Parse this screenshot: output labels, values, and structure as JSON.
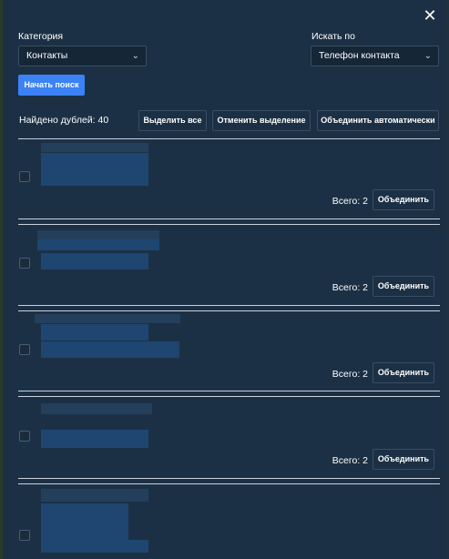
{
  "close_icon": "close-icon",
  "filters": {
    "category_label": "Категория",
    "category_value": "Контакты",
    "search_by_label": "Искать по",
    "search_by_value": "Телефон контакта",
    "start_search": "Начать поиск"
  },
  "toolbar": {
    "found_text": "Найдено дублей: 40",
    "select_all": "Выделить все",
    "deselect": "Отменить выделение",
    "merge_auto": "Объединить автоматически"
  },
  "groups": [
    {
      "total": "Всего: 2",
      "merge": "Объединить"
    },
    {
      "total": "Всего: 2",
      "merge": "Объединить"
    },
    {
      "total": "Всего: 2",
      "merge": "Объединить"
    },
    {
      "total": "Всего: 2",
      "merge": "Объединить"
    },
    {
      "total": "",
      "merge": ""
    }
  ]
}
